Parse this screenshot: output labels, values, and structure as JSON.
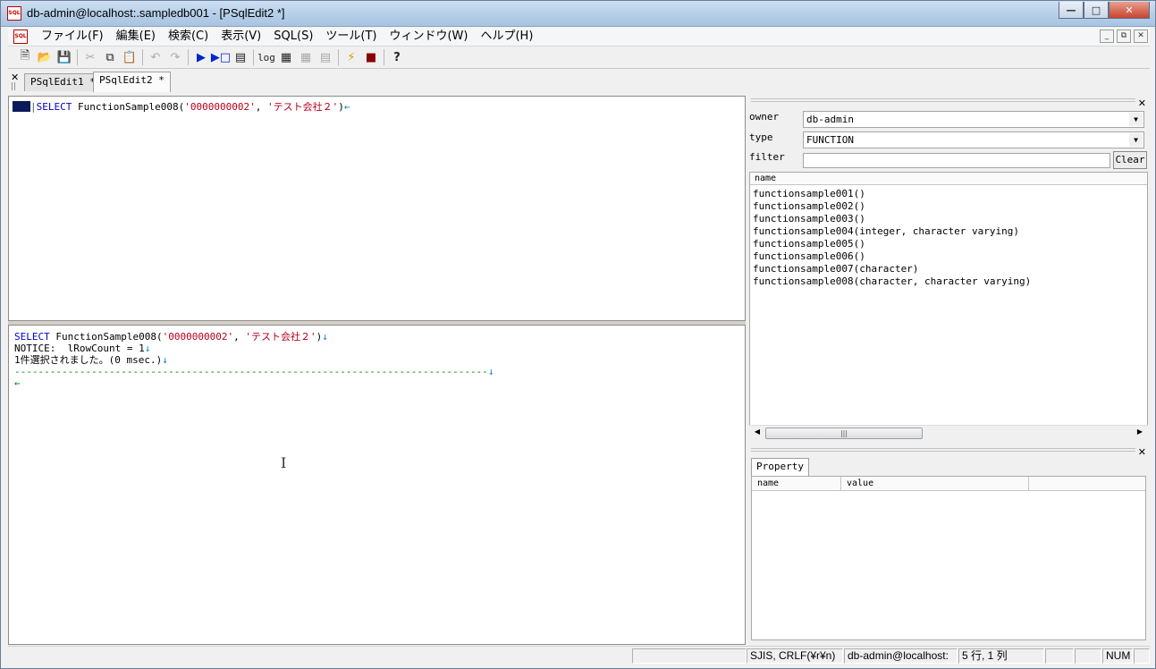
{
  "window": {
    "title": "db-admin@localhost:.sampledb001 - [PSqlEdit2 *]",
    "app_icon_text": "SQL"
  },
  "menu": {
    "items": [
      "ファイル(F)",
      "編集(E)",
      "検索(C)",
      "表示(V)",
      "SQL(S)",
      "ツール(T)",
      "ウィンドウ(W)",
      "ヘルプ(H)"
    ]
  },
  "toolbar": {
    "log_label": "log"
  },
  "tabs": [
    {
      "label": "PSqlEdit1 *"
    },
    {
      "label": "PSqlEdit2 *"
    }
  ],
  "editor": {
    "keyword": "SELECT",
    "function_call": " FunctionSample008(",
    "arg1": "'0000000002'",
    "comma": ", ",
    "arg2": "'テスト会社２'",
    "close": ")",
    "eol": "←"
  },
  "output": {
    "line1_keyword": "SELECT",
    "line1_rest": " FunctionSample008(",
    "line1_arg1": "'0000000002'",
    "line1_comma": ", ",
    "line1_arg2": "'テスト会社２'",
    "line1_close": ")",
    "line2": "NOTICE:  lRowCount = 1",
    "line3": "1件選択されました。(0 msec.)",
    "line4_dashes": "--------------------------------------------------------------------------------",
    "line_down_arrow": "↓",
    "line5_eol": "←"
  },
  "object_browser": {
    "owner_label": "owner",
    "owner_value": "db-admin",
    "type_label": "type",
    "type_value": "FUNCTION",
    "filter_label": "filter",
    "filter_value": "",
    "clear_label": "Clear",
    "list_header": "name",
    "functions": [
      "functionsample001()",
      "functionsample002()",
      "functionsample003()",
      "functionsample004(integer, character varying)",
      "functionsample005()",
      "functionsample006()",
      "functionsample007(character)",
      "functionsample008(character, character varying)"
    ]
  },
  "property_panel": {
    "tab_label": "Property",
    "col_name": "name",
    "col_value": "value"
  },
  "statusbar": {
    "encoding": "SJIS, CRLF(¥r¥n)",
    "connection": "db-admin@localhost:",
    "position": "5 行, 1 列",
    "num": "NUM"
  }
}
